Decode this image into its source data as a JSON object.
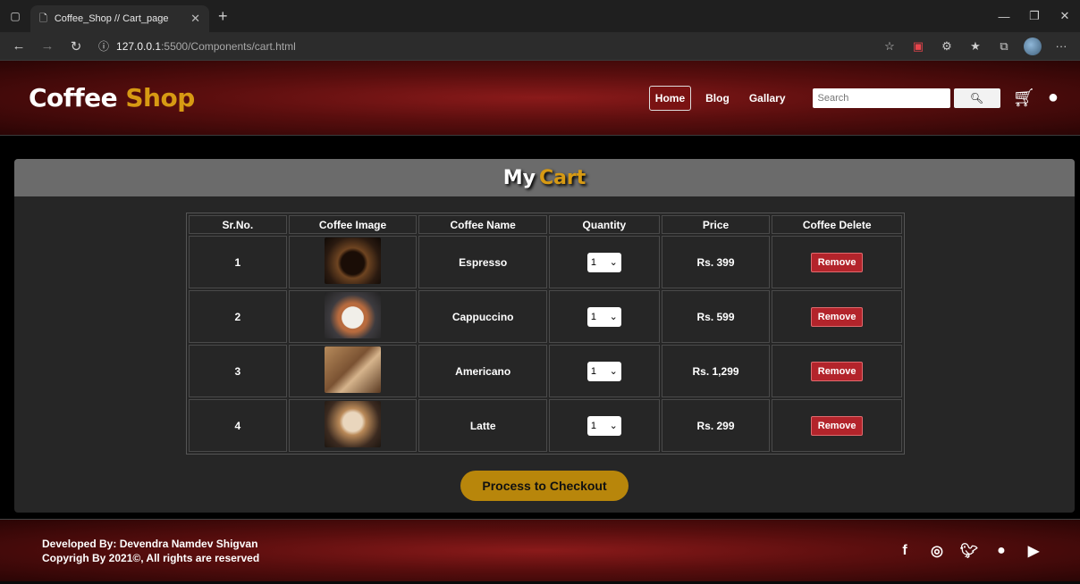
{
  "browser": {
    "tab_title": "Coffee_Shop // Cart_page",
    "url_host": "127.0.0.1",
    "url_path": ":5500/Components/cart.html"
  },
  "header": {
    "brand_main": "Coffee",
    "brand_accent": "Shop",
    "nav": [
      "Home",
      "Blog",
      "Gallary"
    ],
    "search_placeholder": "Search"
  },
  "cart": {
    "title_main": "My",
    "title_accent": "Cart",
    "columns": [
      "Sr.No.",
      "Coffee Image",
      "Coffee Name",
      "Quantity",
      "Price",
      "Coffee Delete"
    ],
    "rows": [
      {
        "sr": "1",
        "name": "Espresso",
        "qty": "1",
        "price": "Rs. 399",
        "remove": "Remove"
      },
      {
        "sr": "2",
        "name": "Cappuccino",
        "qty": "1",
        "price": "Rs. 599",
        "remove": "Remove"
      },
      {
        "sr": "3",
        "name": "Americano",
        "qty": "1",
        "price": "Rs. 1,299",
        "remove": "Remove"
      },
      {
        "sr": "4",
        "name": "Latte",
        "qty": "1",
        "price": "Rs. 299",
        "remove": "Remove"
      }
    ],
    "checkout_label": "Process to Checkout"
  },
  "footer": {
    "developer": "Developed By: Devendra Namdev Shigvan",
    "copyright": "Copyrigh By 2021©, All rights are reserved"
  },
  "colors": {
    "accent": "#d79a13",
    "header_red": "#8a1a1a",
    "remove_red": "#b3242b",
    "checkout_gold": "#b8860b"
  }
}
